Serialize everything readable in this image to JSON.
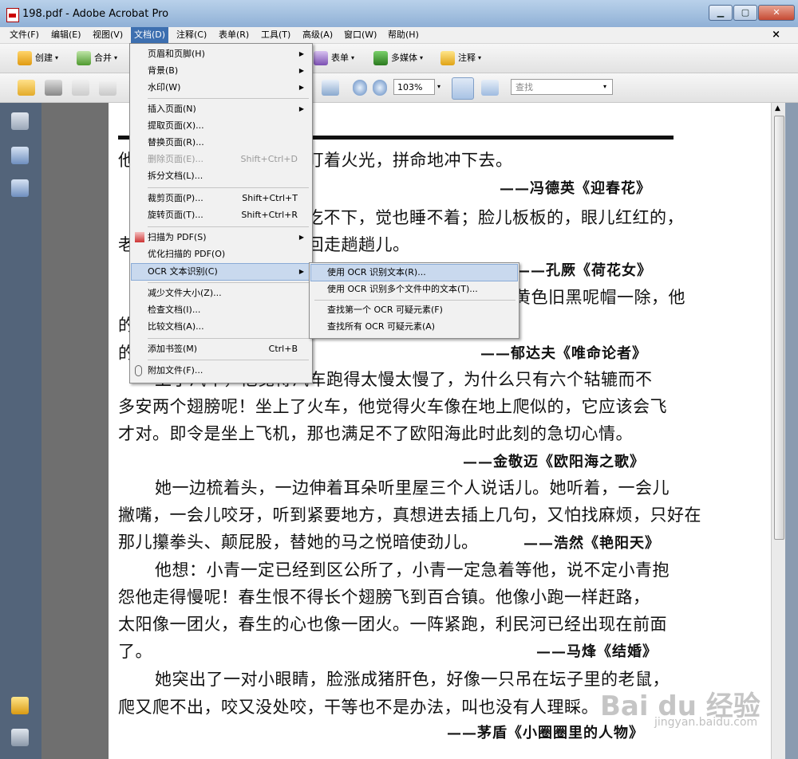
{
  "window": {
    "title": "198.pdf - Adobe Acrobat Pro",
    "buttons": [
      "▁",
      "▢",
      "✕"
    ]
  },
  "menubar": {
    "items": [
      "文件(F)",
      "编辑(E)",
      "视图(V)",
      "文档(D)",
      "注释(C)",
      "表单(R)",
      "工具(T)",
      "高级(A)",
      "窗口(W)",
      "帮助(H)"
    ],
    "doc_close": "×"
  },
  "toolbar1": {
    "create": "创建",
    "combine": "合并",
    "forms": "表单",
    "multimedia": "多媒体",
    "comment": "注释"
  },
  "toolbar2": {
    "zoom": "103%",
    "search_placeholder": "查找"
  },
  "document_menu": {
    "items": [
      {
        "label": "页眉和页脚(H)",
        "shortcut": "",
        "submenu": true,
        "disabled": false
      },
      {
        "label": "背景(B)",
        "shortcut": "",
        "submenu": true,
        "disabled": false
      },
      {
        "label": "水印(W)",
        "shortcut": "",
        "submenu": true,
        "disabled": false
      },
      {
        "label": "插入页面(N)",
        "shortcut": "",
        "submenu": true,
        "disabled": false
      },
      {
        "label": "提取页面(X)...",
        "shortcut": "",
        "submenu": false,
        "disabled": false
      },
      {
        "label": "替换页面(R)...",
        "shortcut": "",
        "submenu": false,
        "disabled": false
      },
      {
        "label": "删除页面(E)...",
        "shortcut": "Shift+Ctrl+D",
        "submenu": false,
        "disabled": true
      },
      {
        "label": "拆分文档(L)...",
        "shortcut": "",
        "submenu": false,
        "disabled": false
      },
      {
        "label": "裁剪页面(P)...",
        "shortcut": "Shift+Ctrl+T",
        "submenu": false,
        "disabled": false
      },
      {
        "label": "旋转页面(T)...",
        "shortcut": "Shift+Ctrl+R",
        "submenu": false,
        "disabled": false
      },
      {
        "label": "扫描为 PDF(S)",
        "shortcut": "",
        "submenu": true,
        "disabled": false
      },
      {
        "label": "优化扫描的 PDF(O)",
        "shortcut": "",
        "submenu": false,
        "disabled": false
      },
      {
        "label": "OCR 文本识别(C)",
        "shortcut": "",
        "submenu": true,
        "disabled": false
      },
      {
        "label": "减少文件大小(Z)...",
        "shortcut": "",
        "submenu": false,
        "disabled": false
      },
      {
        "label": "检查文档(I)...",
        "shortcut": "",
        "submenu": false,
        "disabled": false
      },
      {
        "label": "比较文档(A)...",
        "shortcut": "",
        "submenu": false,
        "disabled": false
      },
      {
        "label": "添加书签(M)",
        "shortcut": "Ctrl+B",
        "submenu": false,
        "disabled": false
      },
      {
        "label": "附加文件(F)...",
        "shortcut": "",
        "submenu": false,
        "disabled": false
      }
    ]
  },
  "ocr_submenu": {
    "items": [
      "使用 OCR 识别文本(R)...",
      "使用 OCR 识别多个文件中的文本(T)...",
      "查找第一个 OCR 可疑元素(F)",
      "查找所有 OCR 可疑元素(A)"
    ]
  },
  "page": {
    "lines": [
      "他忽地爬了起来，眼睛直盯着火光，拼命地冲下去。",
      "吃不下，觉也睡不着；脸儿板板的，眼儿红红的，",
      "老像狮子在笼里迈步，来回走趟趟儿。",
      "黄色旧黑呢帽一除，他",
      "的两步抢上课堂，亮光光",
      "的了珠汗了。",
      "上了汽车，他觉得汽车跑得太慢太慢了，为什么只有六个轱辘而不",
      "多安两个翅膀呢！坐上了火车，他觉得火车像在地上爬似的，它应该会飞",
      "才对。即令是坐上飞机，那也满足不了欧阳海此时此刻的急切心情。",
      "她一边梳着头，一边伸着耳朵听里屋三个人说话儿。她听着，一会儿",
      "撇嘴，一会儿咬牙，听到紧要地方，真想进去插上几句，又怕找麻烦，只好在",
      "那儿攥拳头、颠屁股，替她的马之悦暗使劲儿。",
      "他想：小青一定已经到区公所了，小青一定急着等他，说不定小青抱",
      "怨他走得慢呢！春生恨不得长个翅膀飞到百合镇。他像小跑一样赶路，",
      "太阳像一团火，春生的心也像一团火。一阵紧跑，利民河已经出现在前面",
      "了。",
      "她突出了一对小眼睛，脸涨成猪肝色，好像一只吊在坛子里的老鼠，",
      "爬又爬不出，咬又没处咬，干等也不是办法，叫也没有人理睬。"
    ],
    "sources": [
      "——冯德英《迎春花》",
      "——孔厥《荷花女》",
      "——郁达夫《唯命论者》",
      "——金敬迈《欧阳海之歌》",
      "——浩然《艳阳天》",
      "——马烽《结婚》",
      "——茅盾《小圈圈里的人物》"
    ]
  },
  "watermark": {
    "text": "Bai du 经验",
    "sub": "jingyan.baidu.com"
  }
}
